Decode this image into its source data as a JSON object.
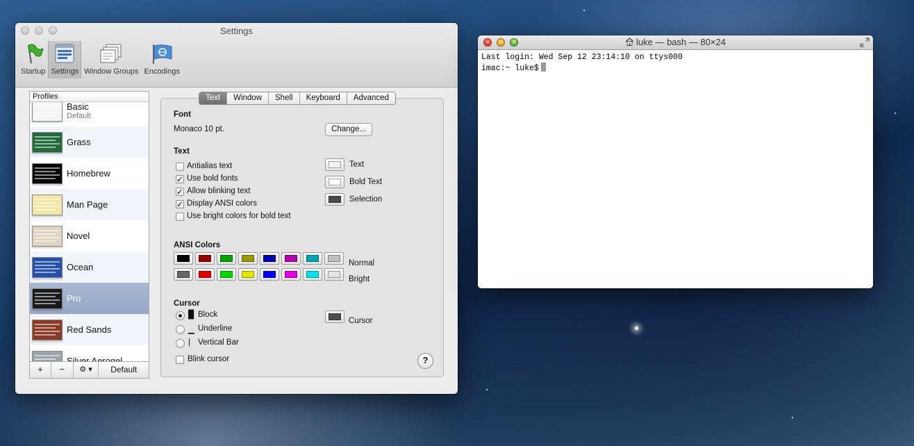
{
  "settings_window": {
    "title": "Settings",
    "toolbar": [
      {
        "label": "Startup",
        "icon": "flag-icon"
      },
      {
        "label": "Settings",
        "icon": "terminal-settings-icon",
        "active": true
      },
      {
        "label": "Window Groups",
        "icon": "window-groups-icon"
      },
      {
        "label": "Encodings",
        "icon": "un-flag-icon"
      }
    ],
    "profiles": {
      "header": "Profiles",
      "items": [
        {
          "name": "Basic",
          "sub": "Default",
          "thumb": "#f4f4f4"
        },
        {
          "name": "Grass",
          "thumb": "#1f6b3a"
        },
        {
          "name": "Homebrew",
          "thumb": "#050505"
        },
        {
          "name": "Man Page",
          "thumb": "#f2e7a2"
        },
        {
          "name": "Novel",
          "thumb": "#dfd6c2"
        },
        {
          "name": "Ocean",
          "thumb": "#2450a8"
        },
        {
          "name": "Pro",
          "thumb": "#1a1a1a",
          "selected": true
        },
        {
          "name": "Red Sands",
          "thumb": "#8a3a26"
        },
        {
          "name": "Silver Aerogel",
          "thumb": "#9ea4ab"
        }
      ],
      "add": "+",
      "remove": "−",
      "gear": "⚙ ▾",
      "default_btn": "Default"
    },
    "tabs": [
      "Text",
      "Window",
      "Shell",
      "Keyboard",
      "Advanced"
    ],
    "active_tab": "Text",
    "font": {
      "heading": "Font",
      "value": "Monaco 10 pt.",
      "change_btn": "Change..."
    },
    "text": {
      "heading": "Text",
      "options": [
        {
          "label": "Antialias text",
          "checked": false
        },
        {
          "label": "Use bold fonts",
          "checked": true
        },
        {
          "label": "Allow blinking text",
          "checked": true
        },
        {
          "label": "Display ANSI colors",
          "checked": true
        },
        {
          "label": "Use bright colors for bold text",
          "checked": false
        }
      ],
      "colors": [
        {
          "label": "Text",
          "color": "#f2f2f2"
        },
        {
          "label": "Bold Text",
          "color": "#ffffff"
        },
        {
          "label": "Selection",
          "color": "#4a4a4a"
        }
      ]
    },
    "ansi": {
      "heading": "ANSI Colors",
      "normal_label": "Normal",
      "bright_label": "Bright",
      "normal": [
        "#000000",
        "#990000",
        "#00a600",
        "#999900",
        "#0000b2",
        "#b200b2",
        "#00a6b2",
        "#bfbfbf"
      ],
      "bright": [
        "#666666",
        "#e50000",
        "#00d900",
        "#e5e500",
        "#0000ff",
        "#e500e5",
        "#00e5e5",
        "#e5e5e5"
      ]
    },
    "cursor": {
      "heading": "Cursor",
      "options": [
        {
          "label": "Block",
          "glyph": "█",
          "selected": true
        },
        {
          "label": "Underline",
          "glyph": "▁",
          "selected": false
        },
        {
          "label": "Vertical Bar",
          "glyph": "|",
          "selected": false
        }
      ],
      "color_label": "Cursor",
      "color": "#4d4d4d",
      "blink_label": "Blink cursor",
      "blink_checked": false
    },
    "help": "?"
  },
  "terminal_window": {
    "title": "luke — bash — 80×24",
    "lines": [
      "Last login: Wed Sep 12 23:14:10 on ttys000",
      "imac:~ luke$"
    ]
  }
}
